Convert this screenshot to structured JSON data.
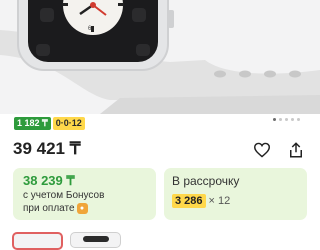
{
  "product": {
    "photo_icon": "watch-photo",
    "gallery": {
      "count": 5,
      "active_index": 0
    },
    "badges": {
      "bonus": "1 182 ₸",
      "installment": "0·0·12"
    },
    "price": "39 421 ₸"
  },
  "bonus_card": {
    "amount": "38 239 ₸",
    "line1": "с учетом Бонусов",
    "line2": "при оплате",
    "coin_icon": "bonus-coin-icon"
  },
  "installment_card": {
    "title": "В рассрочку",
    "amount": "3 286",
    "times": "× 12"
  },
  "colors": {
    "accent_green": "#2e9b3c",
    "accent_yellow": "#ffd84a",
    "card_bg": "#e9f6dc"
  }
}
